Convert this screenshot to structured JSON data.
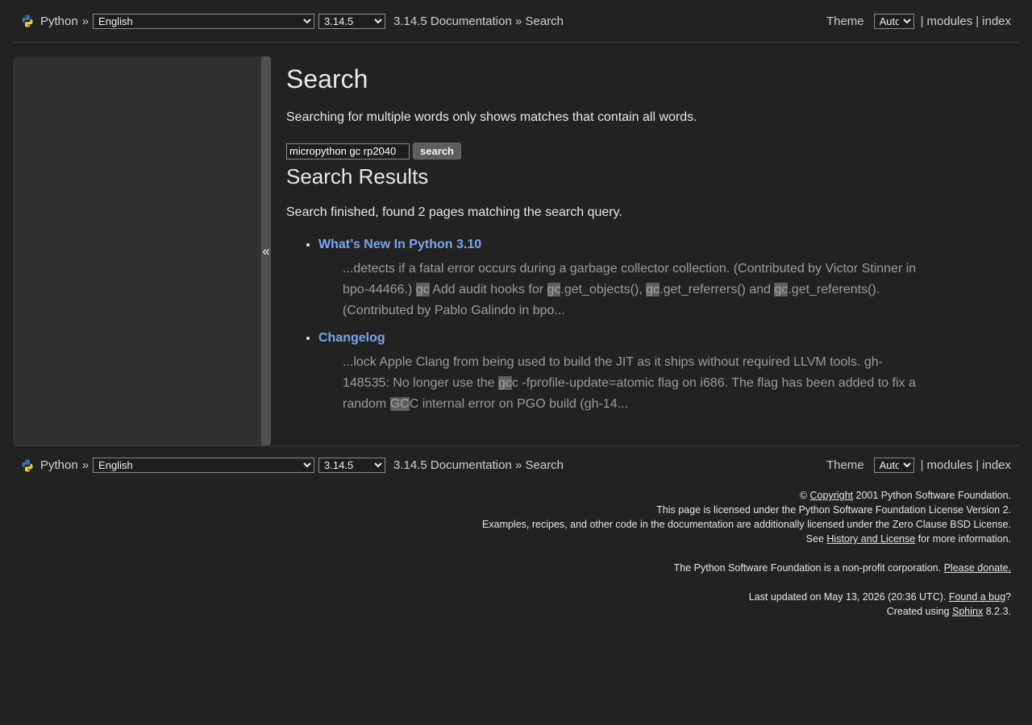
{
  "nav": {
    "brand": "Python",
    "sep": "»",
    "language": "English",
    "version": "3.14.5",
    "crumb_doc": "3.14.5 Documentation",
    "crumb_sep": "»",
    "crumb_current": "Search",
    "theme_label": "Theme",
    "theme_value": "Auto",
    "pipe": "|",
    "modules": "modules",
    "index": "index"
  },
  "sidebar": {
    "collapse_glyph": "«"
  },
  "page": {
    "title": "Search",
    "note": "Searching for multiple words only shows matches that contain all words.",
    "query": "micropython gc rp2040",
    "search_button": "search",
    "results_title": "Search Results",
    "summary": "Search finished, found 2 pages matching the search query."
  },
  "results": [
    {
      "title": "What’s New In Python 3.10",
      "parts": [
        {
          "t": "...detects if a fatal error occurs during a garbage collector collection. (Contributed by Victor Stinner in bpo-44466.) "
        },
        {
          "t": "gc",
          "hl": true
        },
        {
          "t": " Add audit hooks for "
        },
        {
          "t": "gc",
          "hl": true
        },
        {
          "t": ".get_objects(), "
        },
        {
          "t": "gc",
          "hl": true
        },
        {
          "t": ".get_referrers() and "
        },
        {
          "t": "gc",
          "hl": true
        },
        {
          "t": ".get_referents(). (Contributed by Pablo Galindo in bpo..."
        }
      ]
    },
    {
      "title": "Changelog",
      "parts": [
        {
          "t": "...lock Apple Clang from being used to build the JIT as it ships without required LLVM tools. gh-148535: No longer use the "
        },
        {
          "t": "gc",
          "hl": true
        },
        {
          "t": "c -fprofile-update=atomic flag on i686. The flag has been added to fix a random "
        },
        {
          "t": "GC",
          "hl": true
        },
        {
          "t": "C internal error on PGO build (gh-14..."
        }
      ]
    }
  ],
  "footer": {
    "copyright_symbol": "©",
    "copyright_link": "Copyright",
    "copyright_rest": "2001 Python Software Foundation.",
    "license_line": "This page is licensed under the Python Software Foundation License Version 2.",
    "examples_line": "Examples, recipes, and other code in the documentation are additionally licensed under the Zero Clause BSD License.",
    "see_prefix": "See",
    "history_link": "History and License",
    "see_suffix": "for more information.",
    "psf_line": "The Python Software Foundation is a non-profit corporation.",
    "donate_link": "Please donate.",
    "updated_line": "Last updated on May 13, 2026 (20:36 UTC).",
    "bug_link": "Found a bug",
    "bug_suffix": "?",
    "created_prefix": "Created using",
    "sphinx_link": "Sphinx",
    "created_suffix": "8.2.3."
  }
}
